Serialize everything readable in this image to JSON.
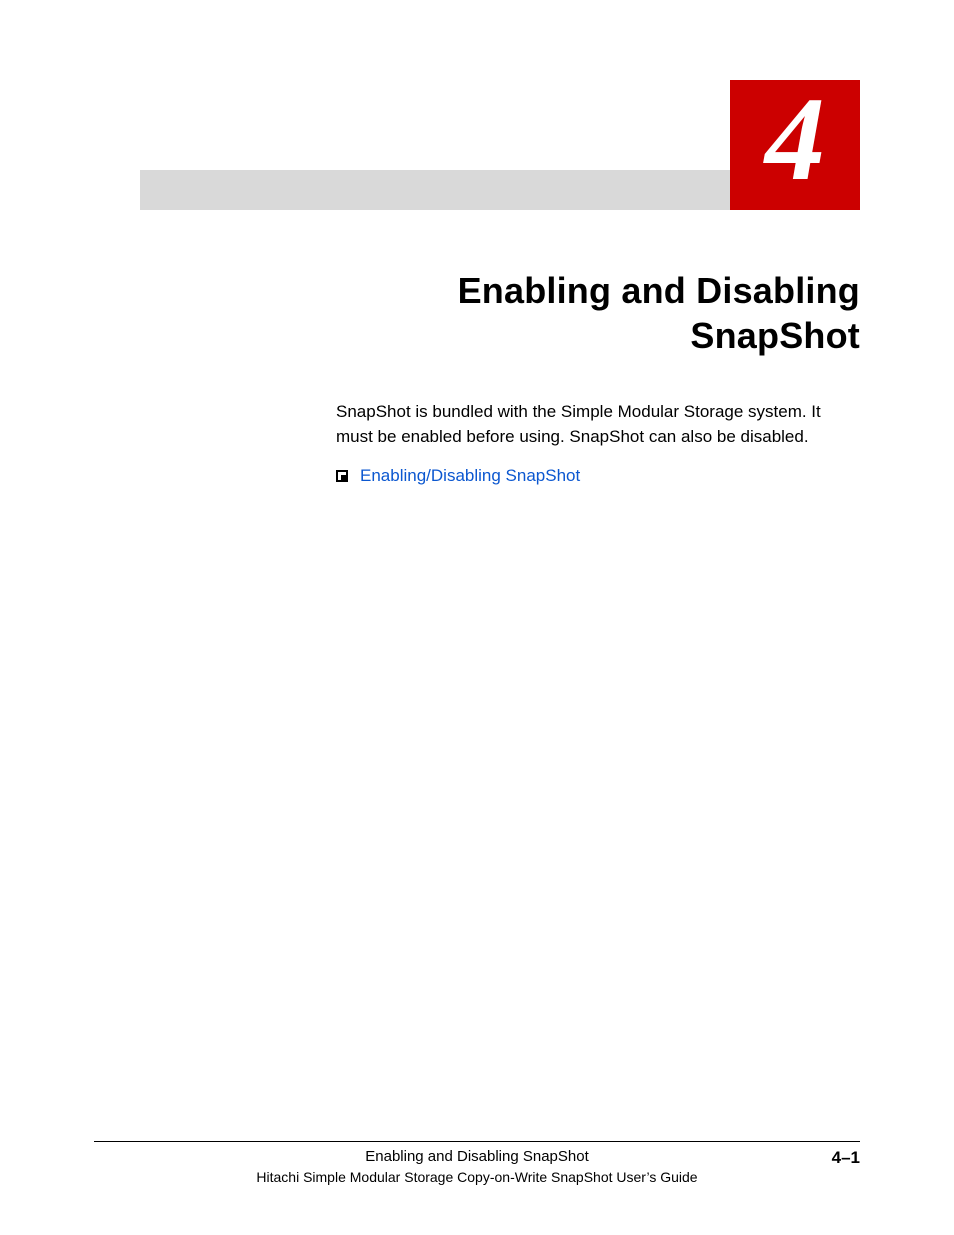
{
  "chapter": {
    "number": "4"
  },
  "title": {
    "line1": "Enabling and Disabling",
    "line2": "SnapShot"
  },
  "intro": "SnapShot is bundled with the Simple Modular Storage system. It must be enabled before using. SnapShot can also be disabled.",
  "toc": {
    "items": [
      "Enabling/Disabling SnapShot"
    ]
  },
  "footer": {
    "section": "Enabling and Disabling SnapShot",
    "page": "4–1",
    "guide": "Hitachi Simple Modular Storage Copy-on-Write SnapShot User’s Guide"
  }
}
